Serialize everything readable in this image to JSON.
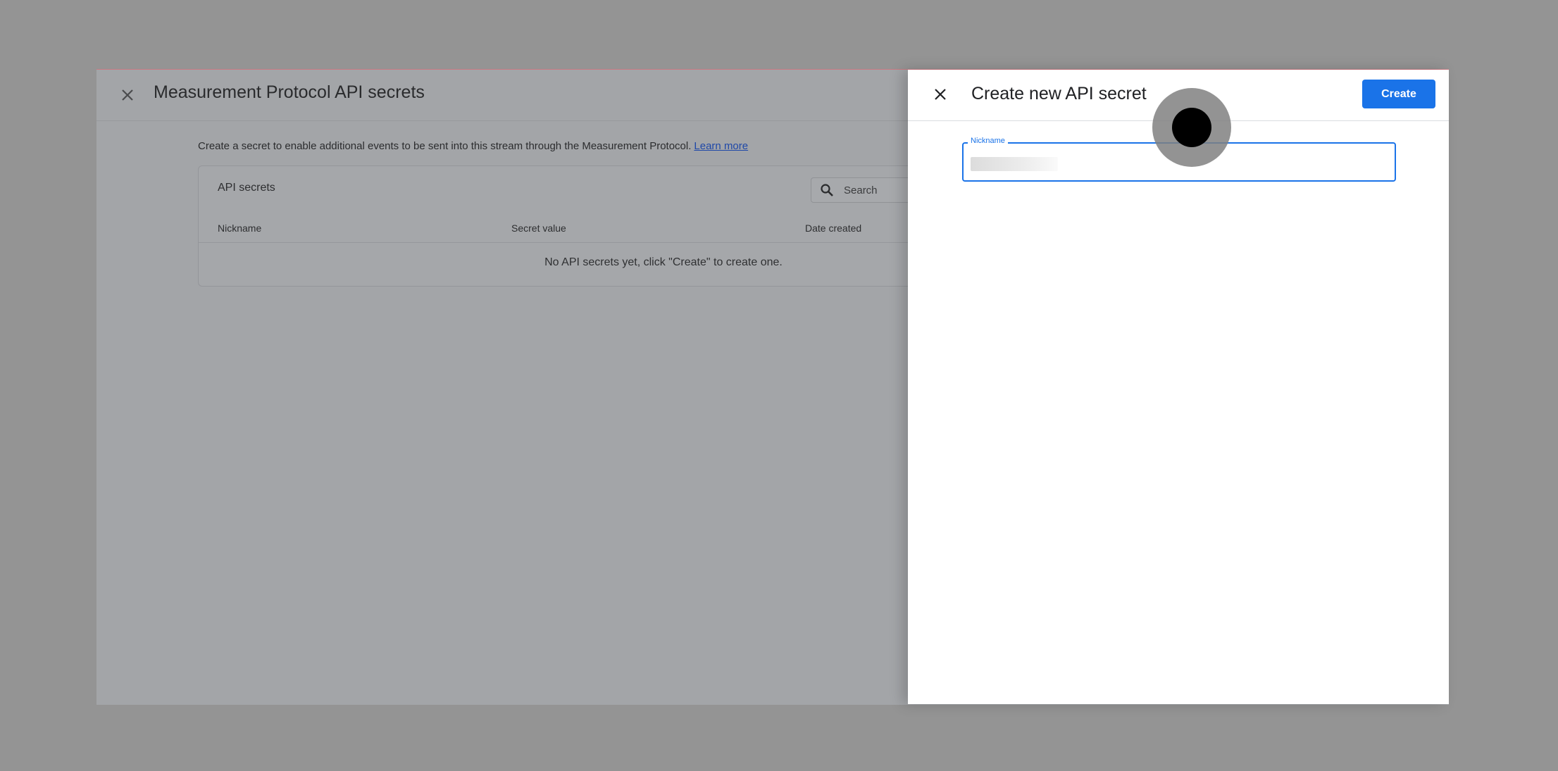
{
  "dialog": {
    "title": "Measurement Protocol API secrets",
    "intro_text": "Create a secret to enable additional events to be sent into this stream through the Measurement Protocol.",
    "learn_more": "Learn more",
    "card": {
      "title": "API secrets",
      "search_placeholder": "Search",
      "columns": [
        "Nickname",
        "Secret value",
        "Date created"
      ],
      "empty_message": "No API secrets yet, click \"Create\" to create one."
    }
  },
  "panel": {
    "title": "Create new API secret",
    "create_label": "Create",
    "nickname_label": "Nickname",
    "nickname_value": ""
  },
  "icons": {
    "dialog_close": "close-icon",
    "panel_close": "close-icon",
    "search": "search-icon"
  },
  "colors": {
    "accent": "#1a73e8",
    "link": "#1f48a8",
    "overlay_background": "#949494"
  }
}
